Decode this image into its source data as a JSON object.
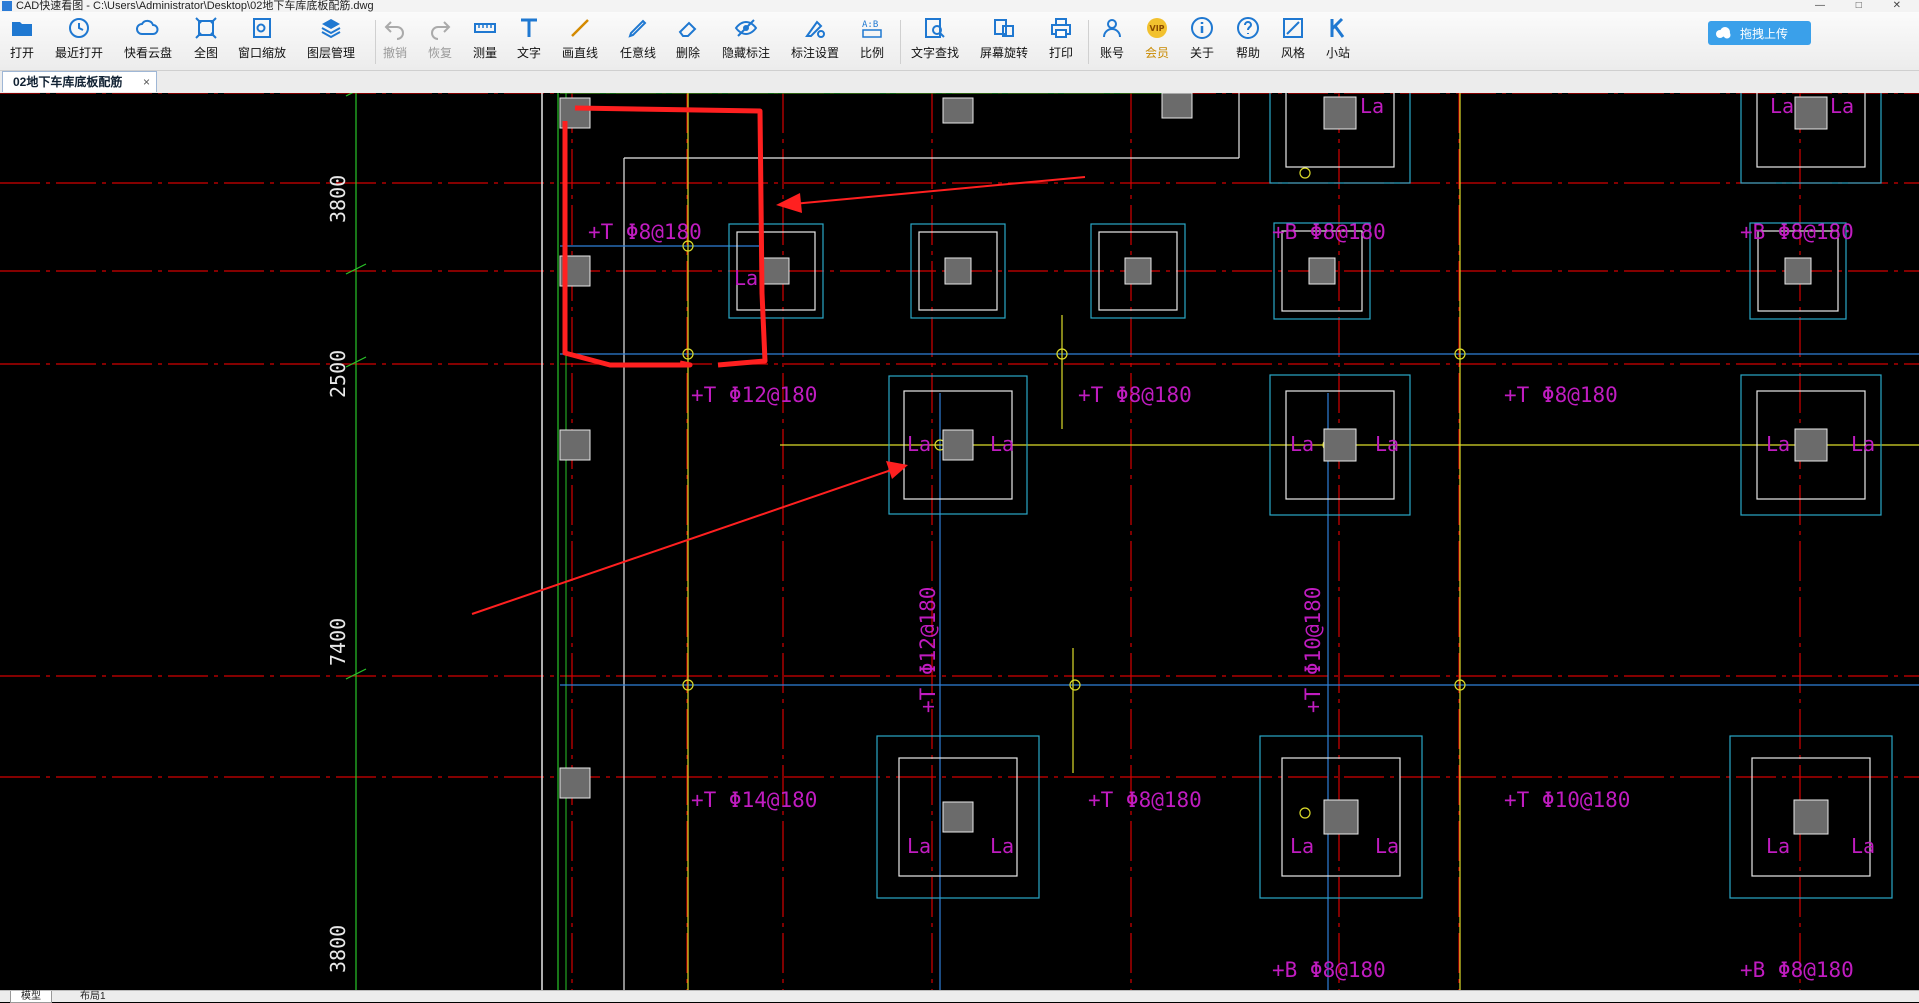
{
  "window": {
    "title": "CAD快速看图 - C:\\Users\\Administrator\\Desktop\\02地下车库底板配筋.dwg"
  },
  "toolbar": {
    "items": [
      {
        "label": "打开",
        "icon": "folder-open-icon"
      },
      {
        "label": "最近打开",
        "icon": "clock-icon"
      },
      {
        "label": "快看云盘",
        "icon": "cloud-icon"
      },
      {
        "label": "全图",
        "icon": "fit-all-icon"
      },
      {
        "label": "窗口缩放",
        "icon": "window-zoom-icon"
      },
      {
        "label": "图层管理",
        "icon": "layers-icon"
      },
      {
        "label": "撤销",
        "icon": "undo-icon"
      },
      {
        "label": "恢复",
        "icon": "redo-icon"
      },
      {
        "label": "测量",
        "icon": "ruler-icon"
      },
      {
        "label": "文字",
        "icon": "text-icon"
      },
      {
        "label": "画直线",
        "icon": "line-icon"
      },
      {
        "label": "任意线",
        "icon": "pen-icon"
      },
      {
        "label": "删除",
        "icon": "eraser-icon"
      },
      {
        "label": "隐藏标注",
        "icon": "eye-icon"
      },
      {
        "label": "标注设置",
        "icon": "annotation-settings-icon"
      },
      {
        "label": "比例",
        "icon": "scale-icon"
      },
      {
        "label": "文字查找",
        "icon": "text-search-icon"
      },
      {
        "label": "屏幕旋转",
        "icon": "rotate-screen-icon"
      },
      {
        "label": "打印",
        "icon": "printer-icon"
      },
      {
        "label": "账号",
        "icon": "user-icon"
      },
      {
        "label": "会员",
        "icon": "vip-icon",
        "badge": "VIP"
      },
      {
        "label": "关于",
        "icon": "info-icon"
      },
      {
        "label": "帮助",
        "icon": "help-icon"
      },
      {
        "label": "风格",
        "icon": "style-icon"
      },
      {
        "label": "小站",
        "icon": "k-station-icon"
      }
    ],
    "upload_label": "拖拽上传"
  },
  "tabs": {
    "doc_tab": "02地下车库底板配筋"
  },
  "layout_tabs": [
    "模型",
    "布局1"
  ],
  "drawing": {
    "dims": [
      "3800",
      "2500",
      "7400",
      "3800"
    ],
    "labels": [
      "+T Φ8@180",
      "+T Φ12@180",
      "+T Φ8@180",
      "+T Φ8@180",
      "+T Φ14@180",
      "+T Φ8@180",
      "+T Φ10@180",
      "+B Φ8@180",
      "+B Φ8@180",
      "+B Φ8@180",
      "+B Φ8@180",
      "+T Φ12@180",
      "+T Φ10@180",
      "La"
    ],
    "colors": {
      "axis_red": "#d40000",
      "beam_blue": "#2f7fd8",
      "cyan": "#2aa8c8",
      "magenta": "#c01cc0",
      "yellow": "#dcdc2a",
      "green": "#28c428",
      "white": "#e8e8e8",
      "annotation_red": "#ff2020"
    }
  }
}
